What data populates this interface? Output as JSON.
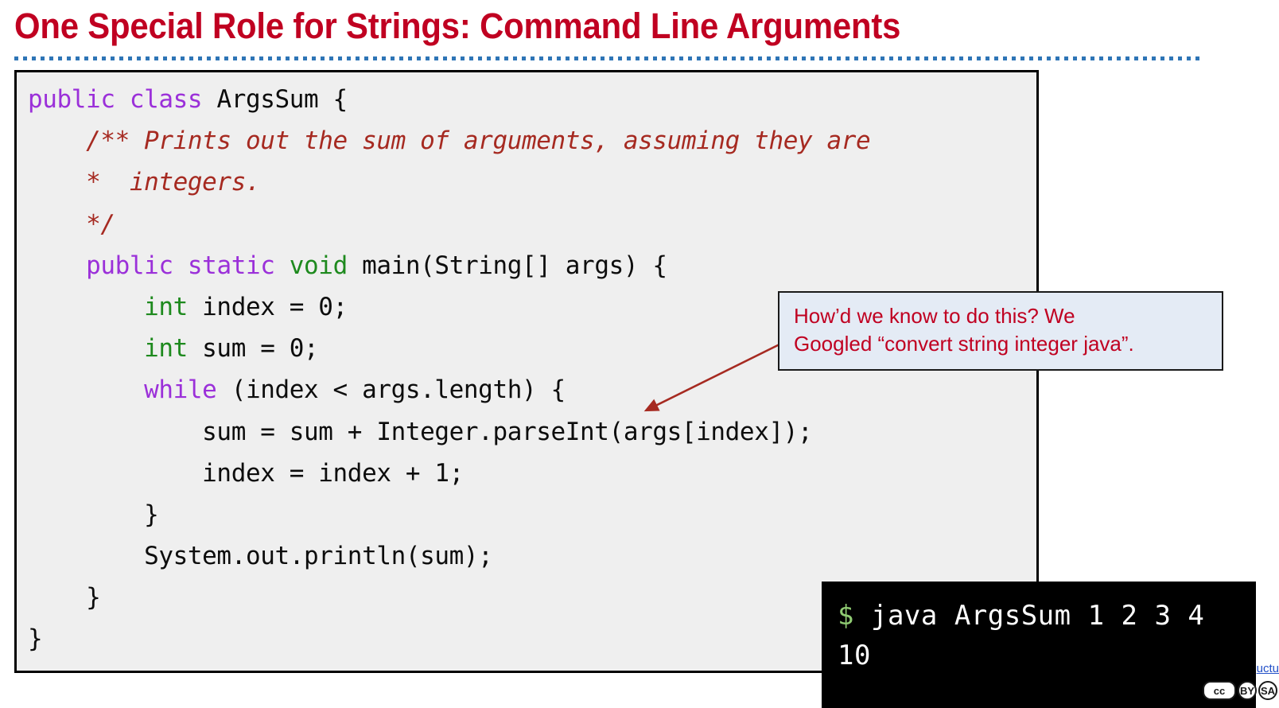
{
  "slide": {
    "title": "One Special Role for Strings: Command Line Arguments",
    "background_color": "#ffffff",
    "title_color": "#C00021",
    "divider_color": "#2E75B6"
  },
  "code_block": {
    "background_color": "#EFEFEF",
    "border_color": "#000000",
    "language": "java",
    "syntax_colors": {
      "keyword": "#9B30D9",
      "type": "#1E8A1E",
      "comment": "#A62A21",
      "plain": "#0d0d0d"
    },
    "lines": [
      {
        "indent": "",
        "tokens": [
          {
            "t": "public",
            "c": "kw"
          },
          {
            "t": " ",
            "c": "pln"
          },
          {
            "t": "class",
            "c": "kw"
          },
          {
            "t": " ArgsSum {",
            "c": "pln"
          }
        ]
      },
      {
        "indent": "    ",
        "tokens": [
          {
            "t": "/** Prints out the sum of arguments, assuming they are",
            "c": "cmt"
          }
        ]
      },
      {
        "indent": "    ",
        "tokens": [
          {
            "t": "*  integers.",
            "c": "cmt"
          }
        ]
      },
      {
        "indent": "    ",
        "tokens": [
          {
            "t": "*/",
            "c": "cmt"
          }
        ]
      },
      {
        "indent": "    ",
        "tokens": [
          {
            "t": "public",
            "c": "kw"
          },
          {
            "t": " ",
            "c": "pln"
          },
          {
            "t": "static",
            "c": "kw"
          },
          {
            "t": " ",
            "c": "pln"
          },
          {
            "t": "void",
            "c": "type"
          },
          {
            "t": " main(String[] args) {",
            "c": "pln"
          }
        ]
      },
      {
        "indent": "        ",
        "tokens": [
          {
            "t": "int",
            "c": "type"
          },
          {
            "t": " index = 0;",
            "c": "pln"
          }
        ]
      },
      {
        "indent": "        ",
        "tokens": [
          {
            "t": "int",
            "c": "type"
          },
          {
            "t": " sum = 0;",
            "c": "pln"
          }
        ]
      },
      {
        "indent": "        ",
        "tokens": [
          {
            "t": "while",
            "c": "kw"
          },
          {
            "t": " (index < args.length) {",
            "c": "pln"
          }
        ]
      },
      {
        "indent": "            ",
        "tokens": [
          {
            "t": "sum = sum + Integer.parseInt(args[index]);",
            "c": "pln"
          }
        ]
      },
      {
        "indent": "            ",
        "tokens": [
          {
            "t": "index = index + 1;",
            "c": "pln"
          }
        ]
      },
      {
        "indent": "        ",
        "tokens": [
          {
            "t": "}",
            "c": "pln"
          }
        ]
      },
      {
        "indent": "        ",
        "tokens": [
          {
            "t": "System.out.println(sum);",
            "c": "pln"
          }
        ]
      },
      {
        "indent": "    ",
        "tokens": [
          {
            "t": "}",
            "c": "pln"
          }
        ]
      },
      {
        "indent": "",
        "tokens": [
          {
            "t": "}",
            "c": "pln"
          }
        ]
      }
    ]
  },
  "callout": {
    "text": "How’d we know to do this? We\nGoogled “convert string integer java”.",
    "background_color": "#E4EBF5",
    "border_color": "#1a1a1a",
    "text_color": "#C00021",
    "arrow_color": "#A62A21"
  },
  "terminal": {
    "background_color": "#000000",
    "prompt_symbol": "$",
    "prompt_color": "#8FCB72",
    "text_color": "#FFFFFF",
    "command": "java ArgsSum 1 2 3 4",
    "output": "10"
  },
  "footer": {
    "link_text": "uctu",
    "link_color": "#2250C8",
    "license_badge": {
      "cc": "cc",
      "by": "BY",
      "sa": "SA"
    }
  }
}
